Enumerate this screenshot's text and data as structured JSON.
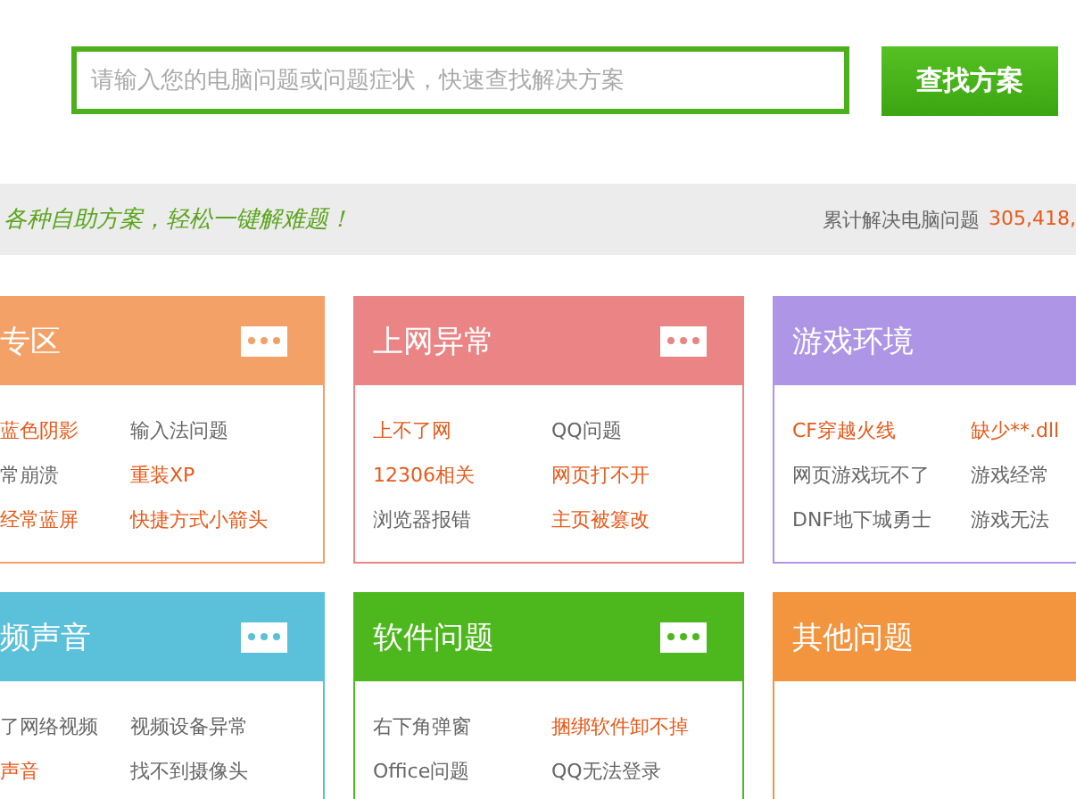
{
  "search": {
    "placeholder": "请输入您的电脑问题或问题症状，快速查找解决方案",
    "button": "查找方案"
  },
  "banner": {
    "slogan": "各种自助方案，轻松一键解难题！",
    "stat_label": "累计解决电脑问题",
    "stat_value": "305,418,"
  },
  "cards": [
    {
      "title": "专区",
      "color": "#f4a167",
      "items": [
        {
          "text": "蓝色阴影",
          "hot": true
        },
        {
          "text": "输入法问题",
          "hot": false
        },
        {
          "text": "常崩溃",
          "hot": false
        },
        {
          "text": "重装XP",
          "hot": true
        },
        {
          "text": "经常蓝屏",
          "hot": true
        },
        {
          "text": "快捷方式小箭头",
          "hot": true
        }
      ]
    },
    {
      "title": "上网异常",
      "color": "#eb8585",
      "items": [
        {
          "text": "上不了网",
          "hot": true
        },
        {
          "text": "QQ问题",
          "hot": false
        },
        {
          "text": "12306相关",
          "hot": true
        },
        {
          "text": "网页打不开",
          "hot": true
        },
        {
          "text": "浏览器报错",
          "hot": false
        },
        {
          "text": "主页被篡改",
          "hot": true
        }
      ]
    },
    {
      "title": "游戏环境",
      "color": "#ae95e6",
      "items": [
        {
          "text": "CF穿越火线",
          "hot": true
        },
        {
          "text": "缺少**.dll",
          "hot": true
        },
        {
          "text": "网页游戏玩不了",
          "hot": false
        },
        {
          "text": "游戏经常",
          "hot": false
        },
        {
          "text": "DNF地下城勇士",
          "hot": false
        },
        {
          "text": "游戏无法",
          "hot": false
        }
      ]
    },
    {
      "title": "频声音",
      "color": "#5bc0d9",
      "items": [
        {
          "text": "了网络视频",
          "hot": false
        },
        {
          "text": "视频设备异常",
          "hot": false
        },
        {
          "text": "声音",
          "hot": true
        },
        {
          "text": "找不到摄像头",
          "hot": false
        }
      ]
    },
    {
      "title": "软件问题",
      "color": "#4db81d",
      "items": [
        {
          "text": "右下角弹窗",
          "hot": false
        },
        {
          "text": "捆绑软件卸不掉",
          "hot": true
        },
        {
          "text": "Office问题",
          "hot": false
        },
        {
          "text": "QQ无法登录",
          "hot": false
        }
      ]
    },
    {
      "title": "其他问题",
      "color": "#f3943f"
    }
  ]
}
